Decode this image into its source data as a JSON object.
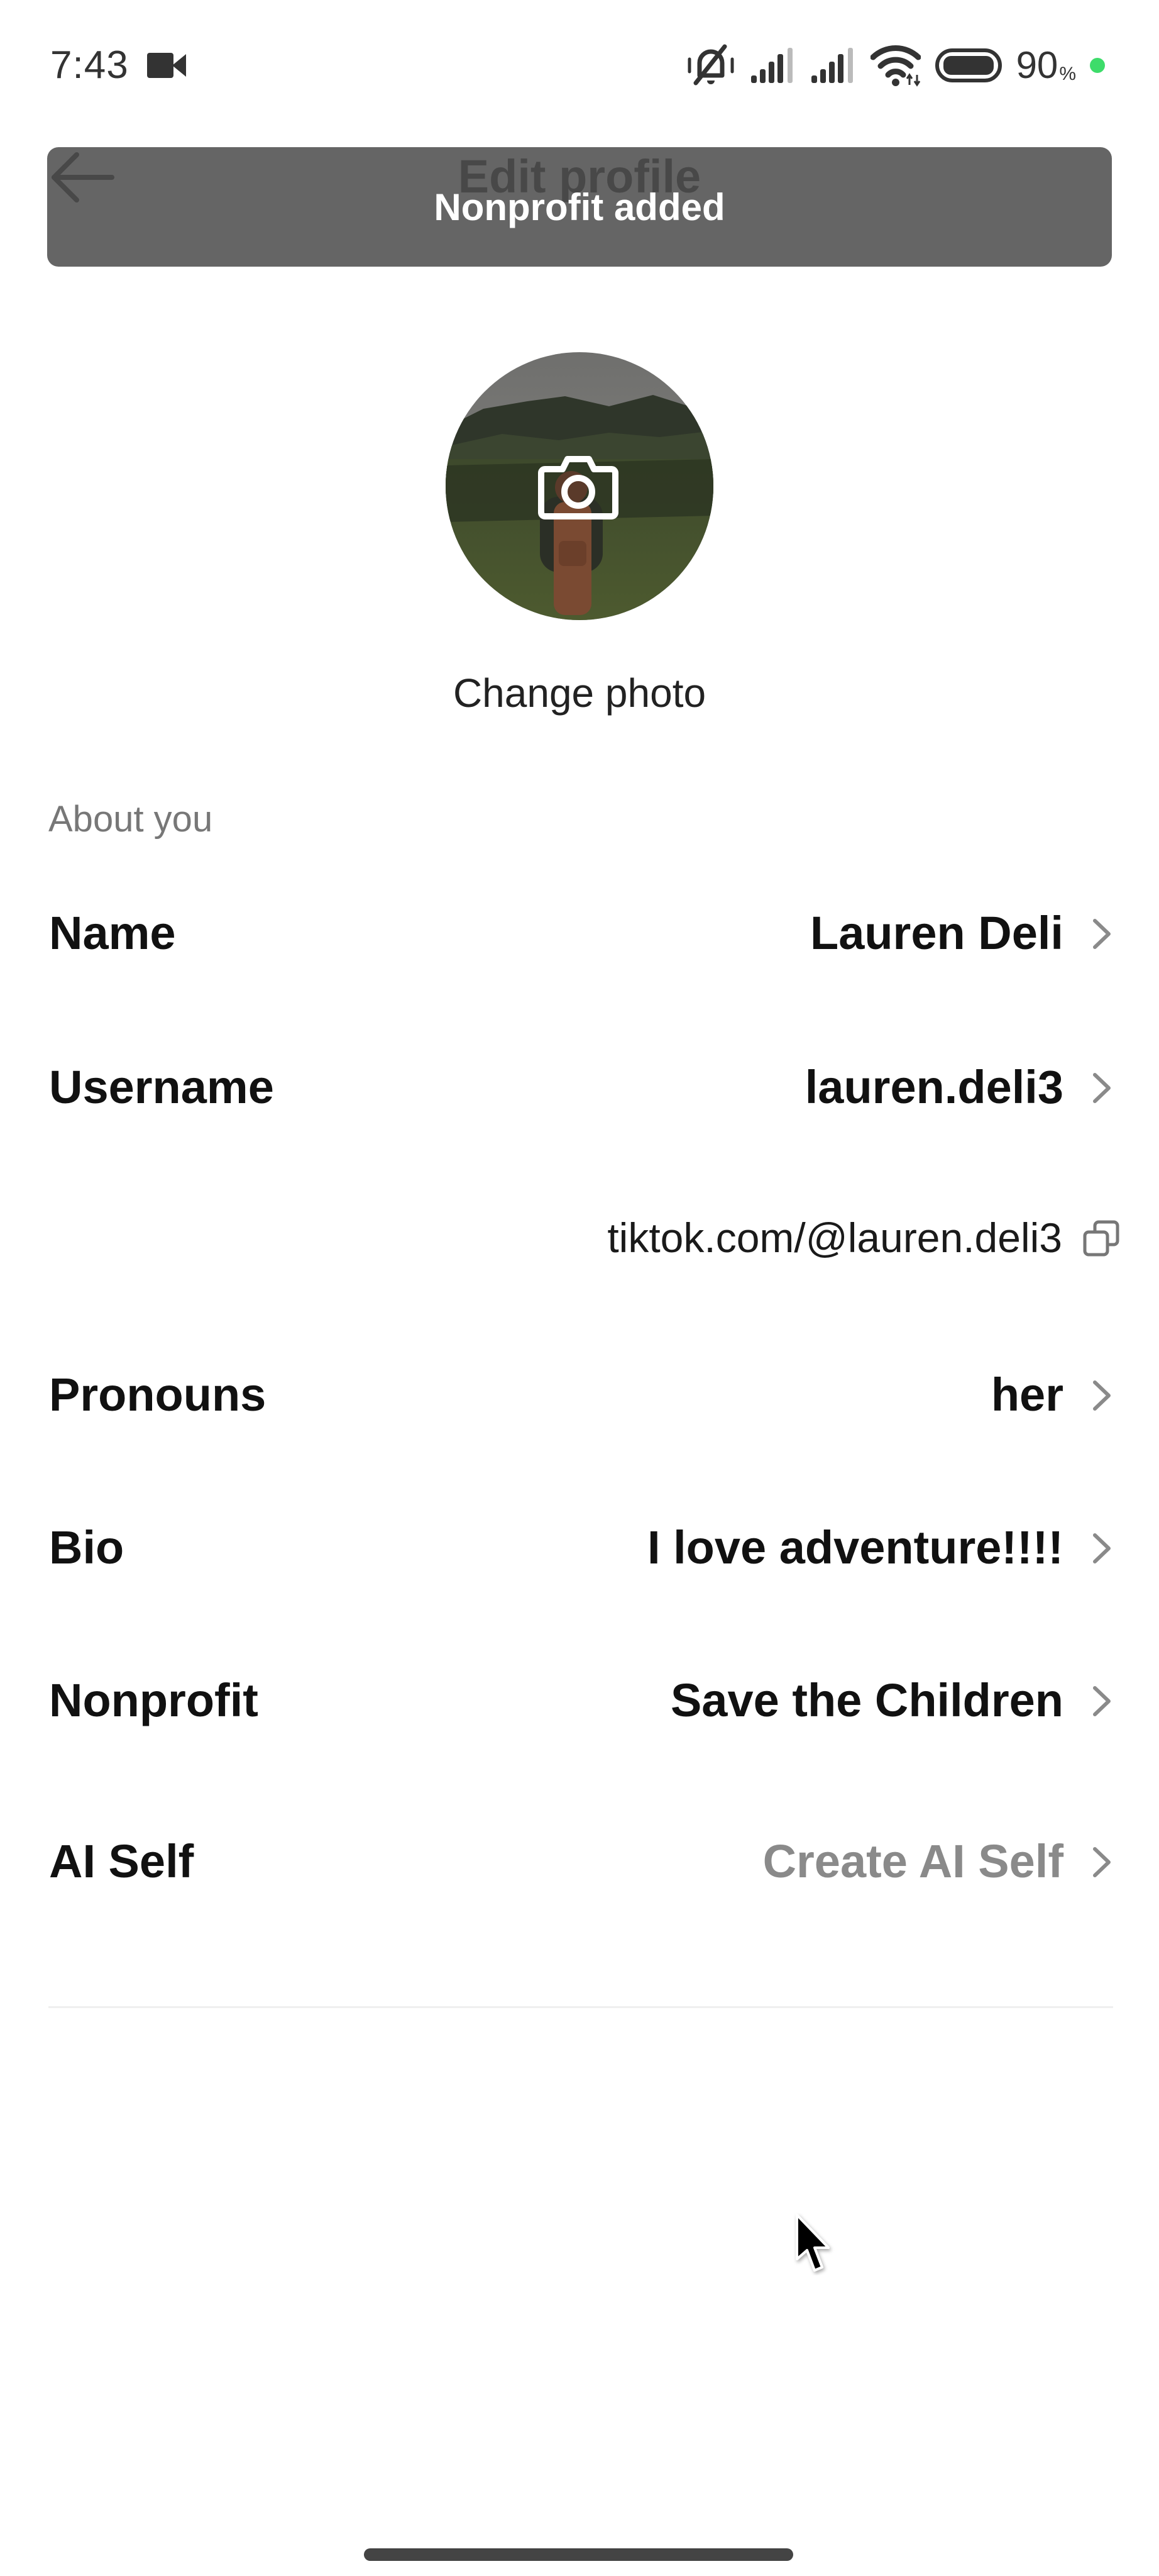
{
  "status_bar": {
    "time": "7:43",
    "left_icons": [
      "video-camera-icon"
    ],
    "right_icons": [
      "bell-muted-icon",
      "signal-1-icon",
      "signal-2-icon",
      "wifi-icon",
      "battery-icon"
    ],
    "battery_percent": "90",
    "battery_unit": "%",
    "indicator_color": "#3ddc6a"
  },
  "header": {
    "title": "Edit profile",
    "back_icon": "arrow-left-icon"
  },
  "toast": {
    "message": "Nonprofit added"
  },
  "avatar": {
    "overlay_icon": "camera-icon",
    "change_photo_label": "Change photo"
  },
  "about_section": {
    "title": "About you",
    "rows": [
      {
        "label": "Name",
        "value": "Lauren Deli",
        "placeholder": false
      },
      {
        "label": "Username",
        "value": "lauren.deli3",
        "placeholder": false
      },
      {
        "label": "Pronouns",
        "value": "her",
        "placeholder": false
      },
      {
        "label": "Bio",
        "value": "I love adventure!!!!",
        "placeholder": false
      },
      {
        "label": "Nonprofit",
        "value": "Save the Children",
        "placeholder": false
      },
      {
        "label": "AI Self",
        "value": "Create AI Self",
        "placeholder": true
      }
    ],
    "profile_link": "tiktok.com/@lauren.deli3",
    "copy_icon": "copy-icon"
  },
  "colors": {
    "toast_bg": "#626262",
    "text_primary": "#111111",
    "text_secondary": "#777777",
    "placeholder": "#8a8a8a",
    "chevron": "#8a8a8a"
  }
}
